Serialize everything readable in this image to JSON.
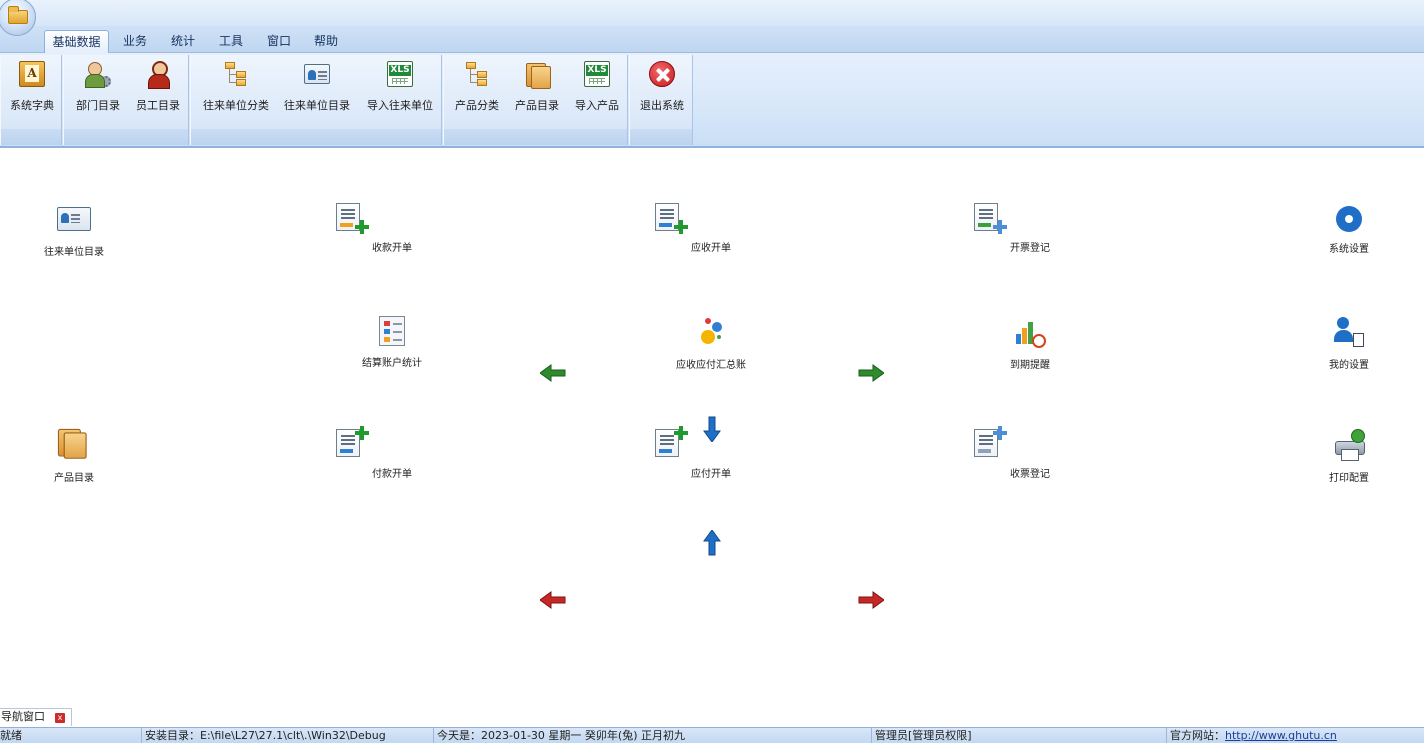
{
  "ribbon_tabs": [
    "基础数据",
    "业务",
    "统计",
    "工具",
    "窗口",
    "帮助"
  ],
  "active_tab": "基础数据",
  "ribbon_buttons": {
    "dictionary": "系统字典",
    "departments": "部门目录",
    "employees": "员工目录",
    "partner_categories": "往来单位分类",
    "partner_directory": "往来单位目录",
    "import_partners": "导入往来单位",
    "product_categories": "产品分类",
    "product_directory": "产品目录",
    "import_products": "导入产品",
    "exit": "退出系统"
  },
  "nav": {
    "partner_directory": "往来单位目录",
    "receipt": "收款开单",
    "receivable": "应收开单",
    "invoice_issue": "开票登记",
    "settings": "系统设置",
    "account_stats": "结算账户统计",
    "ledger": "应收应付汇总账",
    "due_reminder": "到期提醒",
    "my_settings": "我的设置",
    "product_directory": "产品目录",
    "payment": "付款开单",
    "payable": "应付开单",
    "invoice_receive": "收票登记",
    "print_settings": "打印配置"
  },
  "icons": {
    "xls_text": "XLS",
    "panel_close": "x"
  },
  "colors": {
    "ribbon_bg": "#d7e7f9",
    "green_arrow": "#2e8b2e",
    "red_arrow": "#c62828",
    "blue_arrow": "#1f6fc7"
  },
  "bottom_tab": "导航窗口",
  "status": {
    "state": "就绪",
    "install_dir": "安装目录：E:\\file\\L27\\27.1\\clt\\.\\Win32\\Debug",
    "today": "今天是：2023-01-30 星期一 癸卯年(兔) 正月初九",
    "user": "管理员[管理员权限]",
    "website_label": "官方网站：",
    "website_url": "http://www.ghutu.cn"
  }
}
